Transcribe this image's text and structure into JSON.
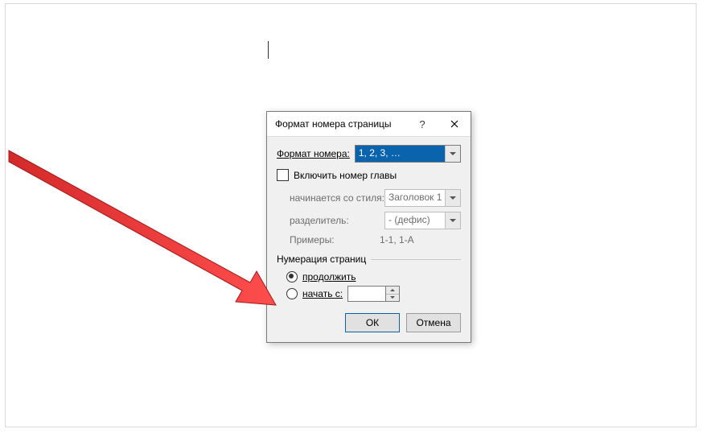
{
  "dialog": {
    "title": "Формат номера страницы",
    "format_label": "Формат номера:",
    "format_value": "1, 2, 3, …",
    "include_chapter_label": "Включить номер главы",
    "include_chapter_checked": false,
    "starts_with_style_label": "начинается со стиля:",
    "starts_with_style_value": "Заголовок 1",
    "separator_label": "разделитель:",
    "separator_value": "-   (дефис)",
    "examples_label": "Примеры:",
    "examples_value": "1-1, 1-A",
    "numbering_group": "Нумерация страниц",
    "radio_continue": "продолжить",
    "radio_start_at": "начать с:",
    "start_at_value": "",
    "ok": "ОК",
    "cancel": "Отмена"
  }
}
